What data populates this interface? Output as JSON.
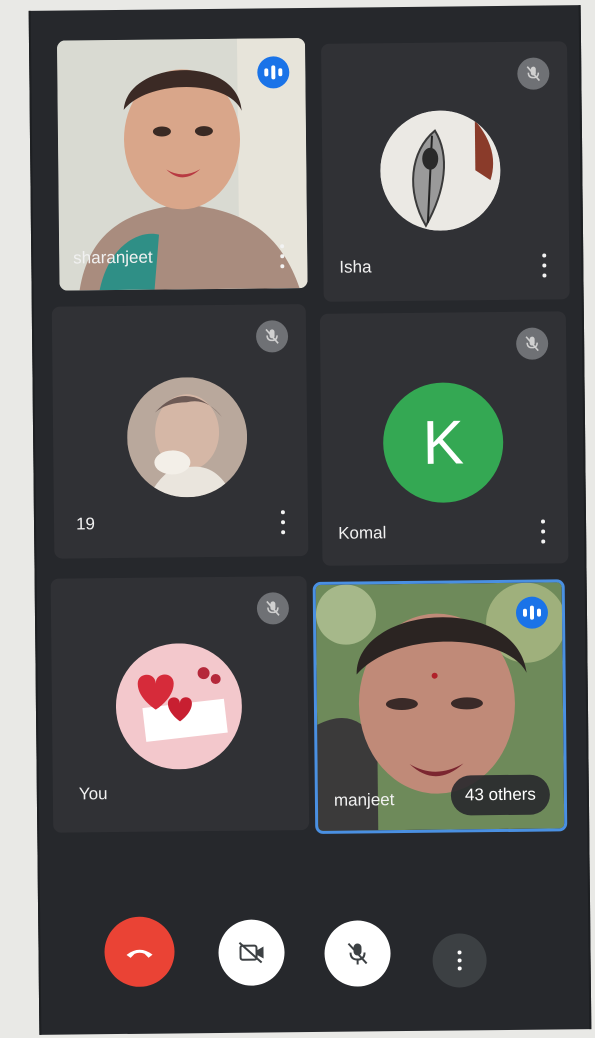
{
  "participants": [
    {
      "name": "sharanjeet",
      "status": "speaking"
    },
    {
      "name": "Isha",
      "status": "muted"
    },
    {
      "name": "19",
      "status": "muted"
    },
    {
      "name": "Komal",
      "status": "muted",
      "initial": "K"
    },
    {
      "name": "You",
      "status": "muted"
    },
    {
      "name": "manjeet",
      "status": "speaking"
    }
  ],
  "overflow_badge": "43 others",
  "colors": {
    "background": "#26282c",
    "tile": "#303135",
    "speaking_blue": "#1a73e8",
    "active_outline": "#4a90e2",
    "end_call_red": "#ea4335",
    "komal_avatar_green": "#34a853"
  },
  "controls": [
    {
      "icon": "end-call-icon"
    },
    {
      "icon": "camera-off-icon"
    },
    {
      "icon": "mic-off-icon"
    },
    {
      "icon": "more-options-icon"
    }
  ]
}
